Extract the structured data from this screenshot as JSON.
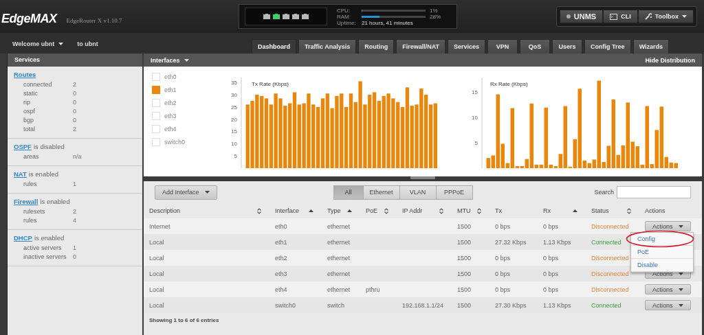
{
  "header": {
    "logo": "EdgeMAX",
    "model": "EdgeRouter X v1.10.7",
    "ports": [
      {
        "up": false
      },
      {
        "up": true
      },
      {
        "up": false
      },
      {
        "up": false
      },
      {
        "up": false
      }
    ],
    "stats": [
      {
        "label": "CPU:",
        "level": 0.01,
        "reading": "1%"
      },
      {
        "label": "RAM:",
        "level": 0.28,
        "reading": "28%"
      }
    ],
    "uptime": {
      "label": "Uptime:",
      "value": "21 hours, 41 minutes"
    },
    "buttons": [
      {
        "kind": "dot",
        "label": "UNMS"
      },
      {
        "kind": "terminal",
        "label": "CLI"
      },
      {
        "kind": "wrench",
        "label": "Toolbox"
      }
    ]
  },
  "user": {
    "welcome": "Welcome ubnt",
    "to": "to ubnt"
  },
  "tabs": [
    {
      "label": "Dashboard",
      "selected": true
    },
    {
      "label": "Traffic Analysis",
      "selected": false
    },
    {
      "label": "Routing",
      "selected": false
    },
    {
      "label": "Firewall/NAT",
      "selected": false
    },
    {
      "label": "Services",
      "selected": false
    },
    {
      "label": "VPN",
      "selected": false
    },
    {
      "label": "QoS",
      "selected": false
    },
    {
      "label": "Users",
      "selected": false
    },
    {
      "label": "Config Tree",
      "selected": false
    },
    {
      "label": "Wizards",
      "selected": false
    }
  ],
  "sidebar": {
    "title": "Services",
    "sections": [
      {
        "link": "Routes",
        "rows": [
          [
            "connected",
            "2"
          ],
          [
            "static",
            "0"
          ],
          [
            "rip",
            "0"
          ],
          [
            "ospf",
            "0"
          ],
          [
            "bgp",
            "0"
          ],
          [
            "total",
            "2"
          ]
        ]
      },
      {
        "link": "OSPF",
        "status": "is disabled",
        "rows": [
          [
            "areas",
            "n/a"
          ]
        ]
      },
      {
        "link": "NAT",
        "status": "is enabled",
        "rows": [
          [
            "rules",
            "1"
          ]
        ]
      },
      {
        "link": "Firewall",
        "status": "is enabled",
        "rows": [
          [
            "rulesets",
            "2"
          ],
          [
            "rules",
            "4"
          ]
        ]
      },
      {
        "link": "DHCP",
        "status": "is enabled",
        "rows": [
          [
            "active servers",
            "1"
          ],
          [
            "inactive servers",
            "0"
          ]
        ]
      }
    ]
  },
  "interfaces_panel": {
    "title": "Interfaces",
    "hide": "Hide Distribution",
    "legend": [
      {
        "label": "eth0",
        "checked": false
      },
      {
        "label": "eth1",
        "checked": true
      },
      {
        "label": "eth2",
        "checked": false
      },
      {
        "label": "eth3",
        "checked": false
      },
      {
        "label": "eth4",
        "checked": false
      },
      {
        "label": "switch0",
        "checked": false
      }
    ],
    "charts": [
      {
        "chart_data": {
          "type": "bar",
          "title": "Tx Rate (Kbps)",
          "ylim": [
            0,
            37
          ],
          "yticks": [
            5,
            10,
            15,
            20,
            25,
            30,
            35
          ],
          "categories": [
            null,
            null,
            null,
            null,
            null,
            null,
            null,
            null,
            null,
            null,
            null,
            null,
            null,
            null,
            null,
            null,
            null,
            null,
            null,
            null,
            null,
            null,
            null,
            null,
            null,
            null,
            null,
            null,
            null,
            null,
            null,
            null,
            null,
            null,
            null,
            null,
            null,
            null,
            null,
            null,
            null
          ],
          "series": [
            {
              "color": "#e8870c",
              "values": [
                26,
                27.5,
                30,
                29.5,
                28.5,
                26,
                30.5,
                28.5,
                25.5,
                26.5,
                31,
                26,
                26.5,
                30.5,
                26,
                25,
                28.5,
                30.5,
                24.5,
                29.5,
                30.5,
                25,
                30.5,
                27,
                35.5,
                26,
                30,
                31,
                27.5,
                29.5,
                30.5,
                28.5,
                27,
                25,
                33,
                25.5,
                26,
                32.5,
                30,
                26,
                26.5
              ]
            }
          ]
        }
      },
      {
        "chart_data": {
          "type": "bar",
          "title": "Rx Rate (Kbps)",
          "ylim": [
            0,
            17.8
          ],
          "yticks": [
            5,
            10,
            15
          ],
          "categories": [
            null,
            null,
            null,
            null,
            null,
            null,
            null,
            null,
            null,
            null,
            null,
            null,
            null,
            null,
            null,
            null,
            null,
            null,
            null,
            null,
            null,
            null,
            null,
            null,
            null,
            null,
            null,
            null,
            null,
            null,
            null,
            null,
            null,
            null,
            null,
            null,
            null,
            null,
            null,
            null
          ],
          "series": [
            {
              "color": "#e8870c",
              "values": [
                2,
                2.5,
                14.5,
                4.8,
                1,
                11.8,
                0.4,
                0.4,
                1.8,
                12.7,
                0.7,
                0.7,
                11.9,
                0.7,
                0.4,
                2.8,
                12.2,
                0.3,
                5.7,
                15.6,
                1.5,
                1,
                1.7,
                17.2,
                1.2,
                4.4,
                13.5,
                2.6,
                4.5,
                12.9,
                5.2,
                4.3,
                0.7,
                12.2,
                0.8,
                7.5,
                12.1,
                2.2,
                1.1,
                1
              ]
            }
          ]
        }
      }
    ]
  },
  "table": {
    "add_button": "Add Interface",
    "filters": [
      {
        "label": "All",
        "selected": true
      },
      {
        "label": "Ethernet",
        "selected": false
      },
      {
        "label": "VLAN",
        "selected": false
      },
      {
        "label": "PPPoE",
        "selected": false
      }
    ],
    "search": {
      "label": "Search"
    },
    "columns": [
      {
        "label": "Description",
        "kind": "sortable"
      },
      {
        "label": "Interface",
        "kind": "sorted"
      },
      {
        "label": "Type",
        "kind": "sorted"
      },
      {
        "label": "PoE",
        "kind": "sortable"
      },
      {
        "label": "IP Addr",
        "kind": "sortable"
      },
      {
        "label": "MTU",
        "kind": "sortable"
      },
      {
        "label": "Tx",
        "kind": "plain"
      },
      {
        "label": "Rx",
        "kind": "sorted"
      },
      {
        "label": "Status",
        "kind": "sortable"
      },
      {
        "label": "Actions",
        "kind": "plain"
      }
    ],
    "rows": [
      {
        "cells": [
          "Internet",
          "eth0",
          "ethernet",
          "",
          "",
          "1500",
          "0 bps",
          "0 bps"
        ],
        "status": "Disconnected",
        "connected": false,
        "action": "Actions"
      },
      {
        "cells": [
          "Local",
          "eth1",
          "ethernet",
          "",
          "",
          "1500",
          "27.32 Kbps",
          "1.13 Kbps"
        ],
        "status": "Connected",
        "connected": true,
        "action": ""
      },
      {
        "cells": [
          "Local",
          "eth2",
          "ethernet",
          "",
          "",
          "1500",
          "0 bps",
          "0 bps"
        ],
        "status": "Disconnected",
        "connected": false,
        "action": ""
      },
      {
        "cells": [
          "Local",
          "eth3",
          "ethernet",
          "",
          "",
          "1500",
          "0 bps",
          "0 bps"
        ],
        "status": "Disconnected",
        "connected": false,
        "action": "Actions"
      },
      {
        "cells": [
          "Local",
          "eth4",
          "ethernet",
          "pthru",
          "",
          "1500",
          "0 bps",
          "0 bps"
        ],
        "status": "Disconnected",
        "connected": false,
        "action": "Actions"
      },
      {
        "cells": [
          "Local",
          "switch0",
          "switch",
          "",
          "192.168.1.1/24",
          "1500",
          "27.30 Kbps",
          "1.13 Kbps"
        ],
        "status": "Connected",
        "connected": true,
        "action": "Actions"
      }
    ],
    "menu": [
      {
        "label": "Config",
        "circled": true
      },
      {
        "label": "PoE",
        "circled": false
      },
      {
        "label": "Disable",
        "circled": false
      }
    ],
    "footer": "Showing 1 to 6 of 6 entries"
  }
}
